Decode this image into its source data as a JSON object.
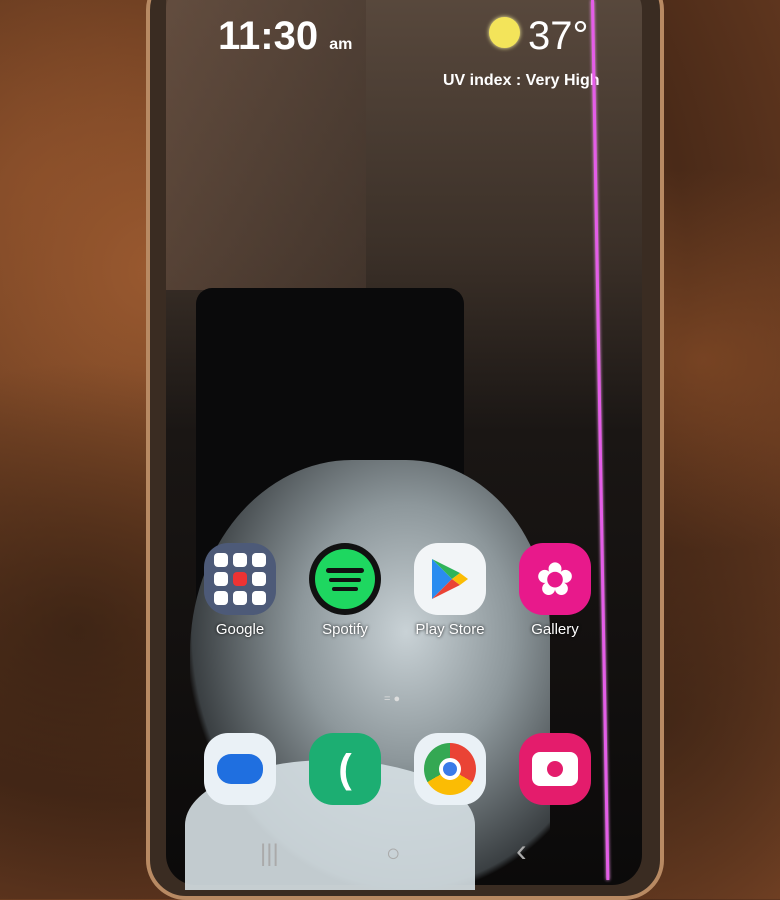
{
  "status": {
    "time": "11:30",
    "ampm": "am",
    "temperature": "37°",
    "weather_icon": "sun-icon",
    "uv_text": "UV index : Very High"
  },
  "apps_row1": [
    {
      "label": "Google",
      "icon": "google-folder-icon",
      "color": "#4d5a78"
    },
    {
      "label": "Spotify",
      "icon": "spotify-icon",
      "color": "#1ed760"
    },
    {
      "label": "Play Store",
      "icon": "play-store-icon",
      "color": "#f2f5f7"
    },
    {
      "label": "Gallery",
      "icon": "gallery-flower-icon",
      "color": "#e8198b"
    }
  ],
  "dock": [
    {
      "icon": "messages-icon",
      "color": "#eaf1f6"
    },
    {
      "icon": "phone-icon",
      "color": "#1cae72"
    },
    {
      "icon": "chrome-icon",
      "color": "#eaf1f6"
    },
    {
      "icon": "camera-icon",
      "color": "#e41c6c"
    }
  ],
  "nav": {
    "recents": "|||",
    "home": "○",
    "back": "‹"
  },
  "colors": {
    "pink_line": "#e45de8"
  }
}
